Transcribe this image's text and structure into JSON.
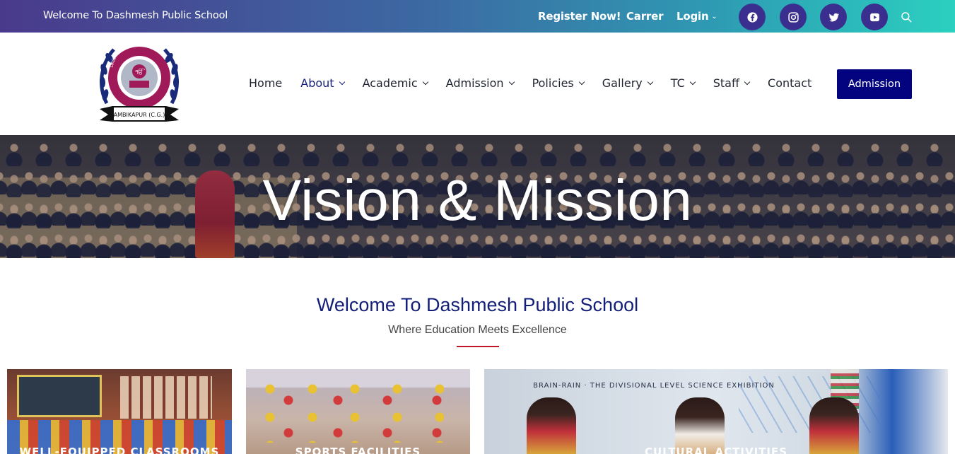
{
  "topbar": {
    "welcome": "Welcome To Dashmesh Public School",
    "register": "Register Now!",
    "carrer": "Carrer",
    "login": "Login",
    "social_icons": [
      "facebook-icon",
      "instagram-icon",
      "twitter-icon",
      "youtube-icon"
    ],
    "search_icon": "search-icon"
  },
  "logo": {
    "text_top": "ਵਿਦਿਆ ਵੀਚਾਰੀ ਤਾਂ ਪਰਉਪਕਾਰੀ",
    "text_ring": "DASHMESH PUBLIC SCHOOL",
    "text_bottom": "AMBIKAPUR (C.G.)"
  },
  "nav": {
    "items": [
      {
        "label": "Home",
        "dropdown": false
      },
      {
        "label": "About",
        "dropdown": true,
        "active": true
      },
      {
        "label": "Academic",
        "dropdown": true
      },
      {
        "label": "Admission",
        "dropdown": true
      },
      {
        "label": "Policies",
        "dropdown": true
      },
      {
        "label": "Gallery",
        "dropdown": true
      },
      {
        "label": "TC",
        "dropdown": true
      },
      {
        "label": "Staff",
        "dropdown": true
      },
      {
        "label": "Contact",
        "dropdown": false
      }
    ],
    "cta_label": "Admission"
  },
  "hero": {
    "title": "Vision & Mission"
  },
  "welcome": {
    "title": "Welcome To Dashmesh Public School",
    "subtitle": "Where Education Meets Excellence"
  },
  "cards": [
    {
      "label": "WELL-EQUIPPED CLASSROOMS"
    },
    {
      "label": "SPORTS FACILITIES"
    },
    {
      "label": "CULTURAL ACTIVITIES",
      "banner": "BRAIN-RAIN · THE DIVISIONAL LEVEL SCIENCE EXHIBITION"
    }
  ],
  "colors": {
    "topbar_start": "#4a3a8c",
    "topbar_end": "#2bd0c0",
    "social_bg": "#3a2f8e",
    "nav_active": "#131e78",
    "cta_bg": "#03037f",
    "accent_line": "#c0182a",
    "welcome_title": "#131e78"
  }
}
